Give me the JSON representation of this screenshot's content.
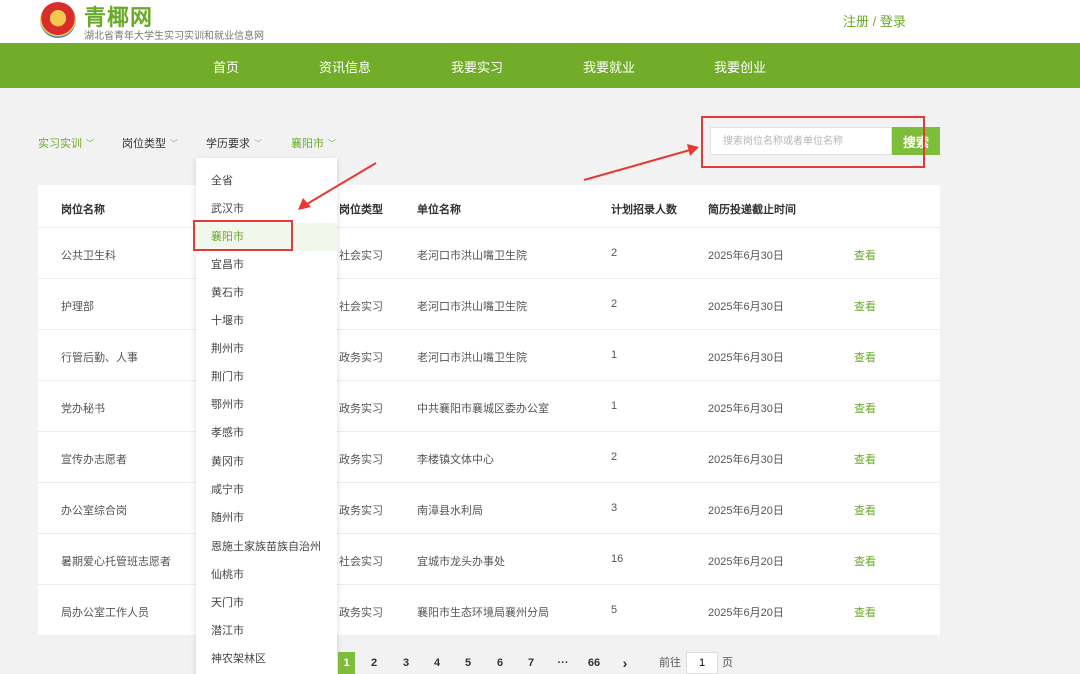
{
  "header": {
    "site_title": "青椰网",
    "site_subtitle": "湖北省青年大学生实习实训和就业信息网",
    "auth_text": "注册 / 登录"
  },
  "nav": [
    "首页",
    "资讯信息",
    "我要实习",
    "我要就业",
    "我要创业"
  ],
  "filters": [
    {
      "label": "实习实训",
      "active": true
    },
    {
      "label": "岗位类型",
      "active": false
    },
    {
      "label": "学历要求",
      "active": false
    },
    {
      "label": "襄阳市",
      "active": true
    }
  ],
  "search": {
    "placeholder": "搜索岗位名称或者单位名称",
    "button_label": "搜索"
  },
  "table": {
    "headers": [
      "岗位名称",
      "岗位类型",
      "单位名称",
      "计划招录人数",
      "简历投递截止时间"
    ],
    "view_label": "查看",
    "rows": [
      {
        "name": "公共卫生科",
        "type": "社会实习",
        "org": "老河口市洪山嘴卫生院",
        "count": "2",
        "deadline": "2025年6月30日"
      },
      {
        "name": "护理部",
        "type": "社会实习",
        "org": "老河口市洪山嘴卫生院",
        "count": "2",
        "deadline": "2025年6月30日"
      },
      {
        "name": "行管后勤、人事",
        "type": "政务实习",
        "org": "老河口市洪山嘴卫生院",
        "count": "1",
        "deadline": "2025年6月30日"
      },
      {
        "name": "党办秘书",
        "type": "政务实习",
        "org": "中共襄阳市襄城区委办公室",
        "count": "1",
        "deadline": "2025年6月30日"
      },
      {
        "name": "宣传办志愿者",
        "type": "政务实习",
        "org": "李楼镇文体中心",
        "count": "2",
        "deadline": "2025年6月30日"
      },
      {
        "name": "办公室综合岗",
        "type": "政务实习",
        "org": "南漳县水利局",
        "count": "3",
        "deadline": "2025年6月20日"
      },
      {
        "name": "暑期爱心托管班志愿者",
        "type": "社会实习",
        "org": "宜城市龙头办事处",
        "count": "16",
        "deadline": "2025年6月20日"
      },
      {
        "name": "局办公室工作人员",
        "type": "政务实习",
        "org": "襄阳市生态环境局襄州分局",
        "count": "5",
        "deadline": "2025年6月20日"
      }
    ]
  },
  "city_dropdown": {
    "selected": "襄阳市",
    "options": [
      "全省",
      "武汉市",
      "襄阳市",
      "宜昌市",
      "黄石市",
      "十堰市",
      "荆州市",
      "荆门市",
      "鄂州市",
      "孝感市",
      "黄冈市",
      "咸宁市",
      "随州市",
      "恩施土家族苗族自治州",
      "仙桃市",
      "天门市",
      "潜江市",
      "神农架林区"
    ]
  },
  "pagination": {
    "pages": [
      "1",
      "2",
      "3",
      "4",
      "5",
      "6",
      "7",
      "···",
      "66"
    ],
    "current": "1",
    "next": "›",
    "goto_prefix": "前往",
    "goto_value": "1",
    "goto_suffix": "页"
  },
  "colors": {
    "brand_green": "#72ad29",
    "button_green": "#7ebd3a",
    "highlight_red": "#e53935"
  }
}
